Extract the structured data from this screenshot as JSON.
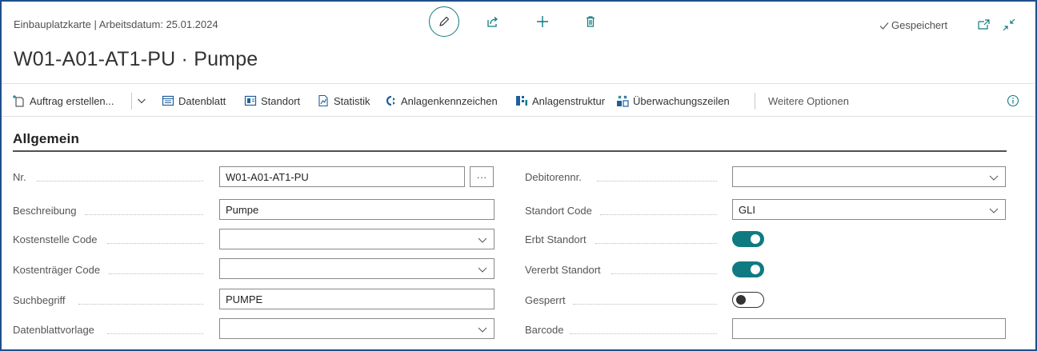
{
  "header": {
    "breadcrumb": "Einbauplatzkarte | Arbeitsdatum: 25.01.2024",
    "title": "W01-A01-AT1-PU · Pumpe",
    "saved_label": "Gespeichert"
  },
  "top_actions": {
    "edit_icon": "pencil-icon",
    "share_icon": "share-icon",
    "new_icon": "plus-icon",
    "delete_icon": "trash-icon"
  },
  "toolbar": {
    "create_order": "Auftrag erstellen...",
    "datasheet": "Datenblatt",
    "location": "Standort",
    "statistics": "Statistik",
    "asset_codes": "Anlagenkennzeichen",
    "asset_structure": "Anlagenstruktur",
    "monitoring_lines": "Überwachungszeilen",
    "more_options": "Weitere Optionen"
  },
  "section": {
    "title": "Allgemein"
  },
  "left_fields": [
    {
      "label": "Nr.",
      "value": "W01-A01-AT1-PU",
      "type": "lookup"
    },
    {
      "label": "Beschreibung",
      "value": "Pumpe",
      "type": "text"
    },
    {
      "label": "Kostenstelle Code",
      "value": "",
      "type": "select"
    },
    {
      "label": "Kostenträger Code",
      "value": "",
      "type": "select"
    },
    {
      "label": "Suchbegriff",
      "value": "PUMPE",
      "type": "text"
    },
    {
      "label": "Datenblattvorlage",
      "value": "",
      "type": "select"
    }
  ],
  "right_fields": [
    {
      "label": "Debitorennr.",
      "value": "",
      "type": "select"
    },
    {
      "label": "Standort Code",
      "value": "GLI",
      "type": "select"
    },
    {
      "label": "Erbt Standort",
      "value": true,
      "type": "toggle"
    },
    {
      "label": "Vererbt Standort",
      "value": true,
      "type": "toggle"
    },
    {
      "label": "Gesperrt",
      "value": false,
      "type": "toggle"
    },
    {
      "label": "Barcode",
      "value": "",
      "type": "text"
    }
  ],
  "colors": {
    "accent": "#0f7a82",
    "frame": "#1f4f8a"
  }
}
